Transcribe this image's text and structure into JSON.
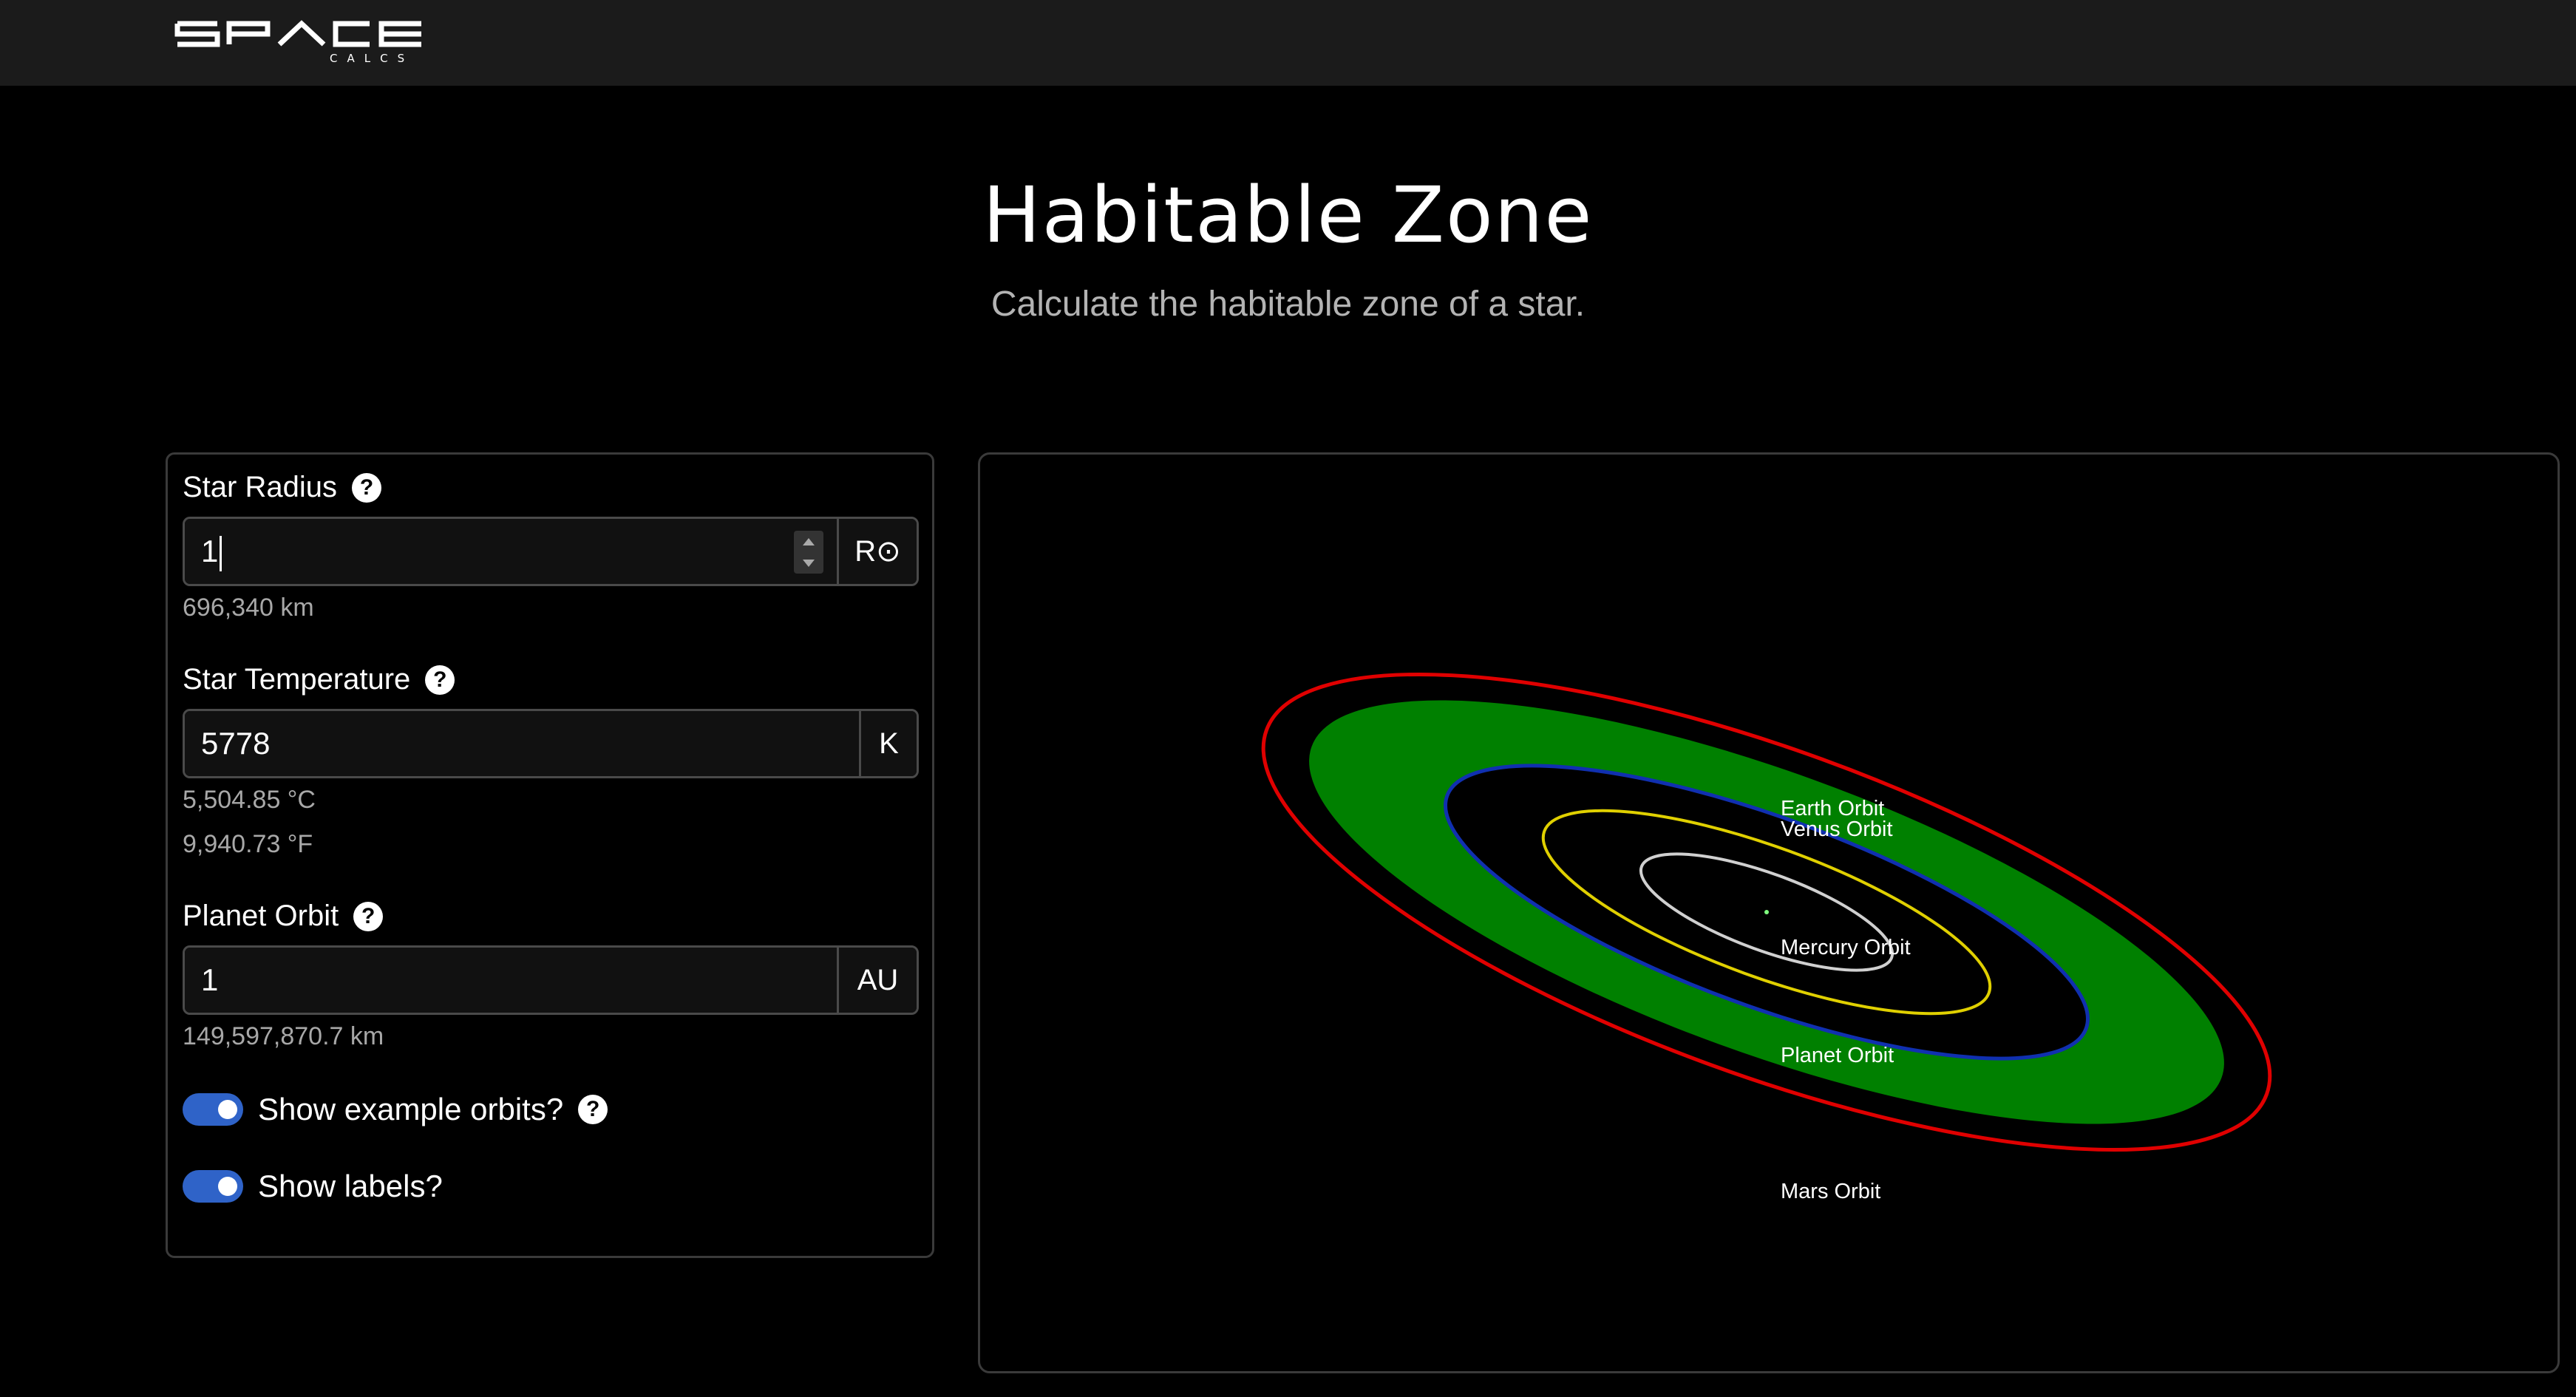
{
  "header": {
    "logo_text": "SPACE",
    "logo_subtext": "CALCS"
  },
  "hero": {
    "title": "Habitable Zone",
    "subtitle": "Calculate the habitable zone of a star."
  },
  "form": {
    "star_radius": {
      "label": "Star Radius",
      "help_icon": "?",
      "value": "1",
      "unit": "R⊙",
      "hint": "696,340 km"
    },
    "star_temperature": {
      "label": "Star Temperature",
      "help_icon": "?",
      "value": "5778",
      "unit": "K",
      "hint_celsius": "5,504.85 °C",
      "hint_fahrenheit": "9,940.73 °F"
    },
    "planet_orbit": {
      "label": "Planet Orbit",
      "help_icon": "?",
      "value": "1",
      "unit": "AU",
      "hint": "149,597,870.7 km"
    },
    "toggles": {
      "show_example_orbits": {
        "label": "Show example orbits?",
        "checked": true,
        "help_icon": "?"
      },
      "show_labels": {
        "label": "Show labels?",
        "checked": true
      }
    }
  },
  "visualization": {
    "labels": {
      "earth": "Earth Orbit",
      "venus": "Venus Orbit",
      "mercury": "Mercury Orbit",
      "planet": "Planet Orbit",
      "mars": "Mars Orbit"
    },
    "colors": {
      "habitable_zone": "#008000",
      "mars_orbit": "#e00000",
      "planet_orbit": "#1030b0",
      "venus_orbit": "#e0d000",
      "mercury_orbit": "#d0d0d0",
      "accent": "#2f63c8"
    }
  }
}
